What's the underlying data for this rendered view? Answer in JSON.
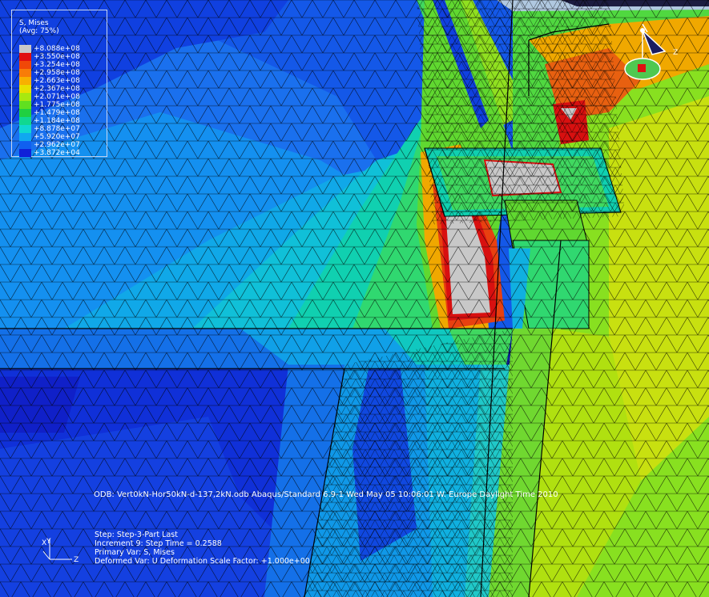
{
  "legend": {
    "title": "S, Mises",
    "subtitle": "(Avg: 75%)",
    "entries": [
      {
        "value": "+8.088e+08",
        "color": "#c8c8c8"
      },
      {
        "value": "+3.550e+08",
        "color": "#e01010"
      },
      {
        "value": "+3.254e+08",
        "color": "#f04808"
      },
      {
        "value": "+2.958e+08",
        "color": "#f87c08"
      },
      {
        "value": "+2.663e+08",
        "color": "#f8b000"
      },
      {
        "value": "+2.367e+08",
        "color": "#e8e000"
      },
      {
        "value": "+2.071e+08",
        "color": "#a8e810"
      },
      {
        "value": "+1.775e+08",
        "color": "#60e020"
      },
      {
        "value": "+1.479e+08",
        "color": "#20d040"
      },
      {
        "value": "+1.184e+08",
        "color": "#10d890"
      },
      {
        "value": "+8.878e+07",
        "color": "#10d8d0"
      },
      {
        "value": "+5.920e+07",
        "color": "#10a8f0"
      },
      {
        "value": "+2.962e+07",
        "color": "#1060f0"
      },
      {
        "value": "+3.872e+04",
        "color": "#1020d8"
      }
    ]
  },
  "info_line": "ODB: Vert0kN-Hor50kN-d-137,2kN.odb    Abaqus/Standard 6.9-1    Wed May 05 10:06:01 W. Europe Daylight Time 2010",
  "step_info": {
    "step": "Step: Step-3-Part Last",
    "increment": "Increment     9: Step Time =    0.2588",
    "primary_var": "Primary Var: S, Mises",
    "deformed_var": "Deformed Var: U   Deformation Scale Factor: +1.000e+00"
  },
  "triad": {
    "y_label": "Y",
    "x_label": "X",
    "z_label": "Z"
  },
  "colors": {
    "background": "#0a1f9a",
    "mesh_line": "#000000",
    "text": "#ffffff"
  }
}
